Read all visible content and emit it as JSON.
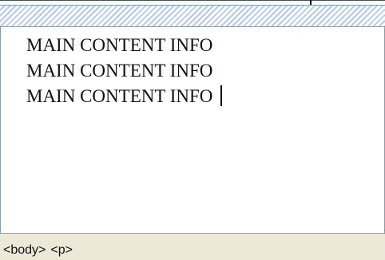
{
  "editor": {
    "lines": [
      "MAIN CONTENT INFO",
      "MAIN CONTENT INFO",
      "MAIN CONTENT INFO"
    ]
  },
  "status_bar": {
    "tags": [
      "<body>",
      "<p>"
    ]
  },
  "colors": {
    "ruler_fill": "#cfdcf4",
    "ruler_stripe": "#b7c9ea",
    "border": "#7f9db9",
    "status_bg": "#ece9d8"
  }
}
